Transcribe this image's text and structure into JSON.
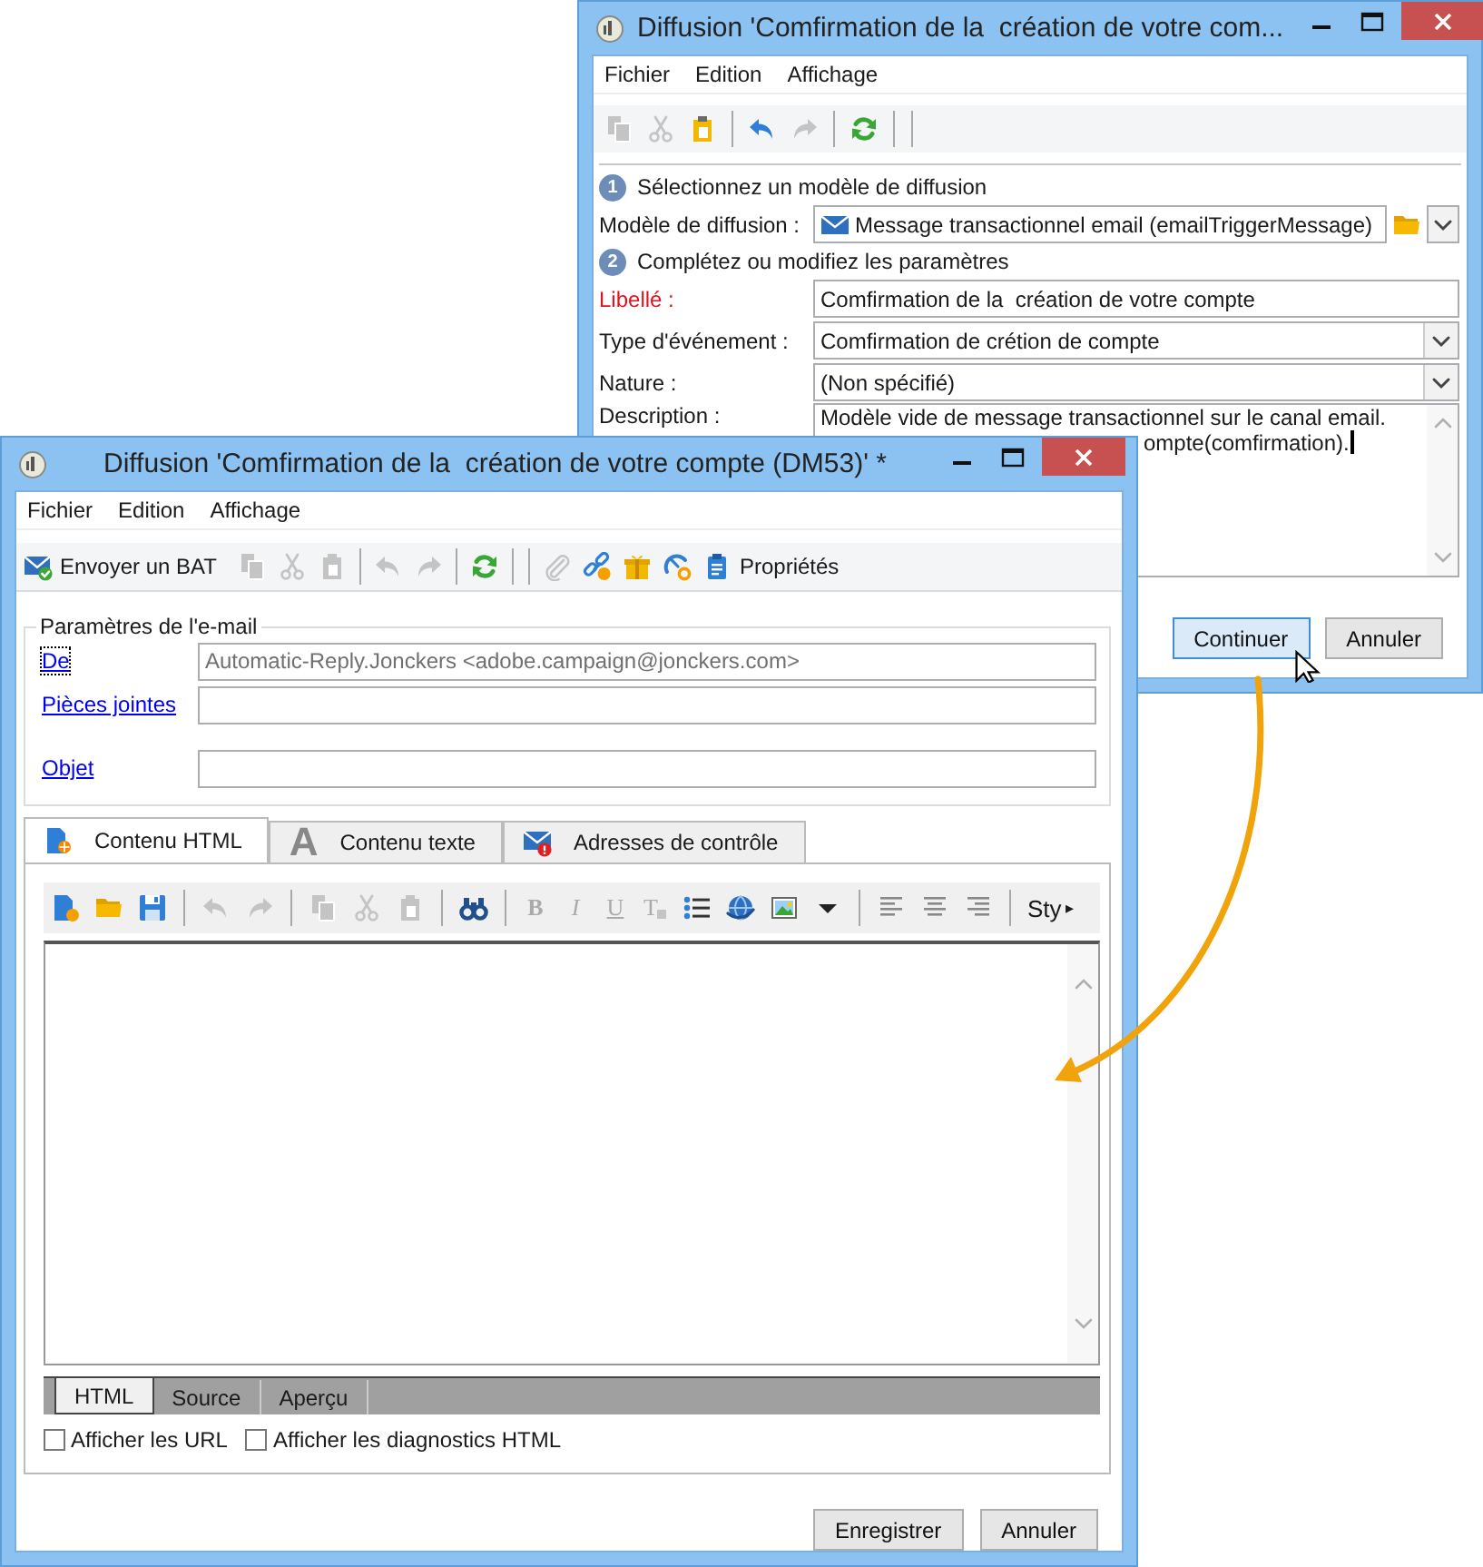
{
  "back_window": {
    "title": "Diffusion 'Comfirmation de la  création de votre com...",
    "menu": [
      "Fichier",
      "Edition",
      "Affichage"
    ],
    "toolbar": [
      {
        "kind": "copy",
        "disabled": true
      },
      {
        "kind": "cut",
        "disabled": true
      },
      {
        "kind": "paste",
        "disabled": false
      },
      {
        "kind": "separator"
      },
      {
        "kind": "undo",
        "disabled": false
      },
      {
        "kind": "redo",
        "disabled": true
      },
      {
        "kind": "separator"
      },
      {
        "kind": "refresh",
        "disabled": false
      },
      {
        "kind": "separator"
      },
      {
        "kind": "separator"
      }
    ],
    "step1": {
      "number": "1",
      "label": "Sélectionnez un modèle de diffusion"
    },
    "template": {
      "label": "Modèle de diffusion :",
      "value": "Message transactionnel email (emailTriggerMessage)"
    },
    "step2": {
      "number": "2",
      "label": "Complétez ou modifiez les paramètres"
    },
    "fields": [
      {
        "label": "Libellé :",
        "value": "Comfirmation de la  création de votre compte",
        "kind": "text",
        "required": true
      },
      {
        "label": "Type d'événement :",
        "value": "Comfirmation de crétion de compte",
        "kind": "select",
        "required": false
      },
      {
        "label": "Nature :",
        "value": "(Non spécifié)",
        "kind": "select",
        "required": false
      }
    ],
    "description": {
      "label": "Description :",
      "lines": [
        "Modèle vide de message transactionnel sur le canal email.",
        "ompte(comfirmation)."
      ]
    },
    "buttons": [
      {
        "label": "Continuer",
        "focused": true
      },
      {
        "label": "Annuler",
        "focused": false
      }
    ]
  },
  "front_window": {
    "title": "Diffusion 'Comfirmation de la  création de votre compte (DM53)' *",
    "menu": [
      "Fichier",
      "Edition",
      "Affichage"
    ],
    "toolbar": [
      {
        "kind": "mail-check",
        "label": "Envoyer un BAT",
        "disabled": false
      },
      {
        "kind": "copy",
        "disabled": true
      },
      {
        "kind": "cut",
        "disabled": true
      },
      {
        "kind": "paste",
        "disabled": true
      },
      {
        "kind": "separator"
      },
      {
        "kind": "undo",
        "disabled": true
      },
      {
        "kind": "redo",
        "disabled": true
      },
      {
        "kind": "separator"
      },
      {
        "kind": "refresh",
        "disabled": false
      },
      {
        "kind": "separator"
      },
      {
        "kind": "separator"
      },
      {
        "kind": "clip",
        "disabled": true
      },
      {
        "kind": "link",
        "disabled": false
      },
      {
        "kind": "gift",
        "disabled": false
      },
      {
        "kind": "gauge",
        "disabled": false
      },
      {
        "kind": "clipboard",
        "label": "Propriétés",
        "disabled": false
      }
    ],
    "group_title": "Paramètres de l'e-mail",
    "fields": [
      {
        "label": "De",
        "value": "Automatic-Reply.Jonckers <adobe.campaign@jonckers.com>",
        "focused": true
      },
      {
        "label": "Pièces jointes",
        "focused": false
      },
      {
        "label": "Objet",
        "focused": false
      }
    ],
    "tabs": [
      {
        "label": "Contenu HTML",
        "selected": true,
        "kind": "html"
      },
      {
        "label": "Contenu texte",
        "selected": false,
        "kind": "text",
        "glyph": "A"
      },
      {
        "label": "Adresses de contrôle",
        "selected": false,
        "kind": "addresses"
      }
    ],
    "editor_toolbar": [
      {
        "kind": "new-doc",
        "disabled": false
      },
      {
        "kind": "folder",
        "disabled": false
      },
      {
        "kind": "save",
        "disabled": false
      },
      {
        "kind": "separator"
      },
      {
        "kind": "undo",
        "disabled": true
      },
      {
        "kind": "redo",
        "disabled": true
      },
      {
        "kind": "separator"
      },
      {
        "kind": "copy",
        "disabled": true
      },
      {
        "kind": "cut",
        "disabled": true
      },
      {
        "kind": "paste",
        "disabled": true
      },
      {
        "kind": "separator"
      },
      {
        "kind": "binoculars",
        "disabled": false
      },
      {
        "kind": "separator"
      },
      {
        "kind": "bold",
        "glyph": "B",
        "disabled": true
      },
      {
        "kind": "italic",
        "glyph": "I",
        "disabled": true
      },
      {
        "kind": "underline",
        "glyph": "U",
        "disabled": true
      },
      {
        "kind": "clear",
        "glyph": "T",
        "disabled": true
      },
      {
        "kind": "list",
        "disabled": false
      },
      {
        "kind": "globe",
        "disabled": false
      },
      {
        "kind": "image",
        "disabled": false
      },
      {
        "kind": "caret",
        "disabled": false
      },
      {
        "kind": "separator"
      },
      {
        "kind": "align-left",
        "disabled": false
      },
      {
        "kind": "align-center",
        "disabled": false
      },
      {
        "kind": "align-right",
        "disabled": false
      },
      {
        "kind": "separator"
      },
      {
        "kind": "menu",
        "label": "Sty",
        "glyph": "▸"
      }
    ],
    "view_tabs": [
      {
        "label": "HTML",
        "selected": true
      },
      {
        "label": "Source",
        "selected": false
      },
      {
        "label": "Aperçu",
        "selected": false
      }
    ],
    "checkboxes": [
      {
        "label": "Afficher les URL",
        "checked": false
      },
      {
        "label": "Afficher les diagnostics HTML",
        "checked": false
      }
    ],
    "buttons": [
      {
        "label": "Enregistrer"
      },
      {
        "label": "Annuler"
      }
    ]
  }
}
